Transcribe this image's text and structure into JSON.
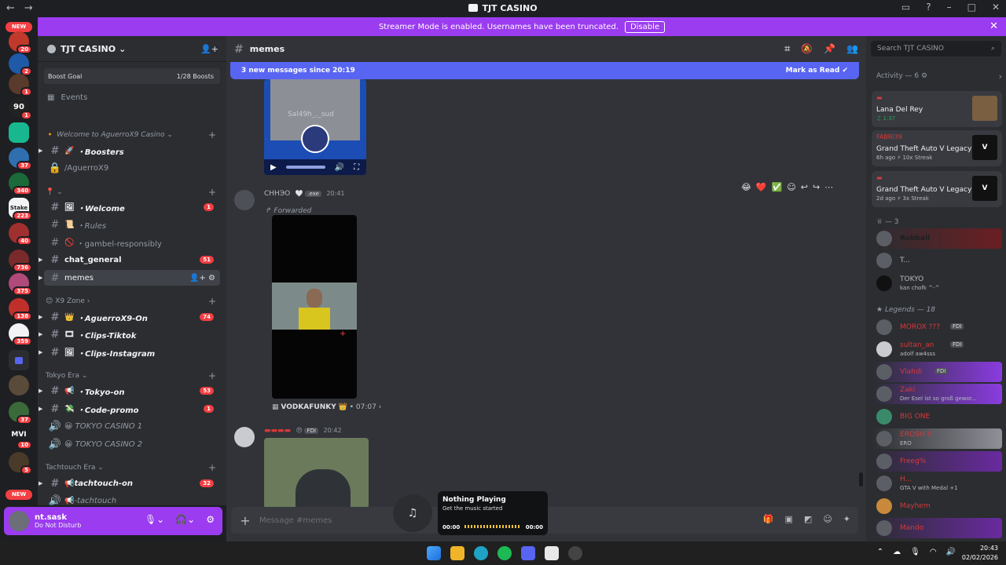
{
  "window": {
    "title": "TJT CASINO",
    "controls": [
      "▭",
      "?",
      "–",
      "□",
      "✕"
    ]
  },
  "banner": {
    "text": "Streamer Mode is enabled. Usernames have been truncated.",
    "button": "Disable"
  },
  "server_rail": {
    "new_top": "NEW",
    "new_bottom": "NEW",
    "badges": [
      "20",
      "2",
      "1",
      "1",
      "37",
      "340",
      "223",
      "40",
      "736",
      "375",
      "138",
      "359",
      "37",
      "10",
      "5"
    ],
    "server_text": [
      "90",
      "Stake",
      "MVI"
    ]
  },
  "guild": {
    "name": "TJT CASINO",
    "boost_label": "Boost Goal",
    "boost_value": "1/28 Boosts",
    "events": "Events"
  },
  "categories": {
    "welcome": "Welcome to AguerroX9 Casino",
    "empty": "⌄",
    "x9zone": "X9 Zone",
    "tokyo": "Tokyo Era",
    "tachtouch": "Tachtouch Era"
  },
  "channels": [
    {
      "name": "・Boosters",
      "count": ""
    },
    {
      "name": "/AguerroX9",
      "count": ""
    },
    {
      "name": "・Welcome",
      "count": "1"
    },
    {
      "name": "・Rules",
      "count": ""
    },
    {
      "name": "・gambel-responsibly",
      "count": ""
    },
    {
      "name": "chat_general",
      "count": "51"
    },
    {
      "name": "memes",
      "count": ""
    },
    {
      "name": "・AguerroX9-On",
      "count": "74"
    },
    {
      "name": "・Clips-Tiktok",
      "count": ""
    },
    {
      "name": "・Clips-Instagram",
      "count": ""
    },
    {
      "name": "・Tokyo-on",
      "count": "53"
    },
    {
      "name": "・Code-promo",
      "count": "1"
    },
    {
      "name": "TOKYO CASINO 1",
      "count": ""
    },
    {
      "name": "TOKYO CASINO 2",
      "count": ""
    },
    {
      "name": "tachtouch-on",
      "count": "32"
    },
    {
      "name": "-tachtouch",
      "count": ""
    }
  ],
  "user": {
    "name": "nt.sask",
    "status": "Do Not Disturb"
  },
  "chat": {
    "channel": "memes",
    "new_messages": "3 new messages since 20:19",
    "mark_read": "Mark as Read",
    "video_watermark": "Sal49h_._sud",
    "msg1_name": "СННЭО",
    "msg1_tag": ".exe",
    "msg1_time": "20:41",
    "forwarded": "Forwarded",
    "source_name": "VODKAFUNKY",
    "source_time": "• 07:07",
    "msg2_tag": "FDI",
    "msg2_time": "20:42",
    "composer_placeholder": "Message #memes"
  },
  "player": {
    "title": "Nothing Playing",
    "subtitle": "Get the music started",
    "time_start": "00:00",
    "time_end": "00:00"
  },
  "members": {
    "search_placeholder": "Search TJT CASINO",
    "activity_header": "Activity — 6",
    "activities": [
      {
        "title": "Lana Del Rey",
        "meta": "♫ 1:37"
      },
      {
        "title": "Grand Theft Auto V Legacy",
        "meta": "6h ago  ⚡ 10x Streak",
        "top": "FABRI39"
      },
      {
        "title": "Grand Theft Auto V Legacy",
        "meta": "2d ago  ⚡ 3x Streak"
      }
    ],
    "group1": "— 3",
    "group1_members": [
      {
        "name": "Robball",
        "sub": ""
      },
      {
        "name": "T...",
        "sub": ""
      },
      {
        "name": "TOKYO",
        "sub": "kan chofk ^-^"
      }
    ],
    "group2": "Legends — 18",
    "group2_members": [
      {
        "name": "MOROX ???",
        "sub": "",
        "tag": "FDI"
      },
      {
        "name": "sultan_an",
        "sub": "adolf aw4sss",
        "tag": "FDI"
      },
      {
        "name": "Vlahdi",
        "sub": "",
        "tag": "FDI"
      },
      {
        "name": "Zaki",
        "sub": "Der Esel ist so groß gewor...",
        "tag": ""
      },
      {
        "name": "BIG ONE",
        "sub": "",
        "tag": ""
      },
      {
        "name": "EROSH !!",
        "sub": "ERO",
        "tag": ""
      },
      {
        "name": "Freeg%",
        "sub": "",
        "tag": ""
      },
      {
        "name": "H...",
        "sub": "GTA V with Medal +1",
        "tag": ""
      },
      {
        "name": "Mayhem",
        "sub": "",
        "tag": ""
      },
      {
        "name": "Mando",
        "sub": "",
        "tag": ""
      }
    ]
  },
  "taskbar": {
    "time": "20:43",
    "date": "02/02/2026"
  },
  "colors": {
    "accent": "#9b3cf0",
    "blurple": "#5865f2",
    "danger": "#f23f43"
  }
}
